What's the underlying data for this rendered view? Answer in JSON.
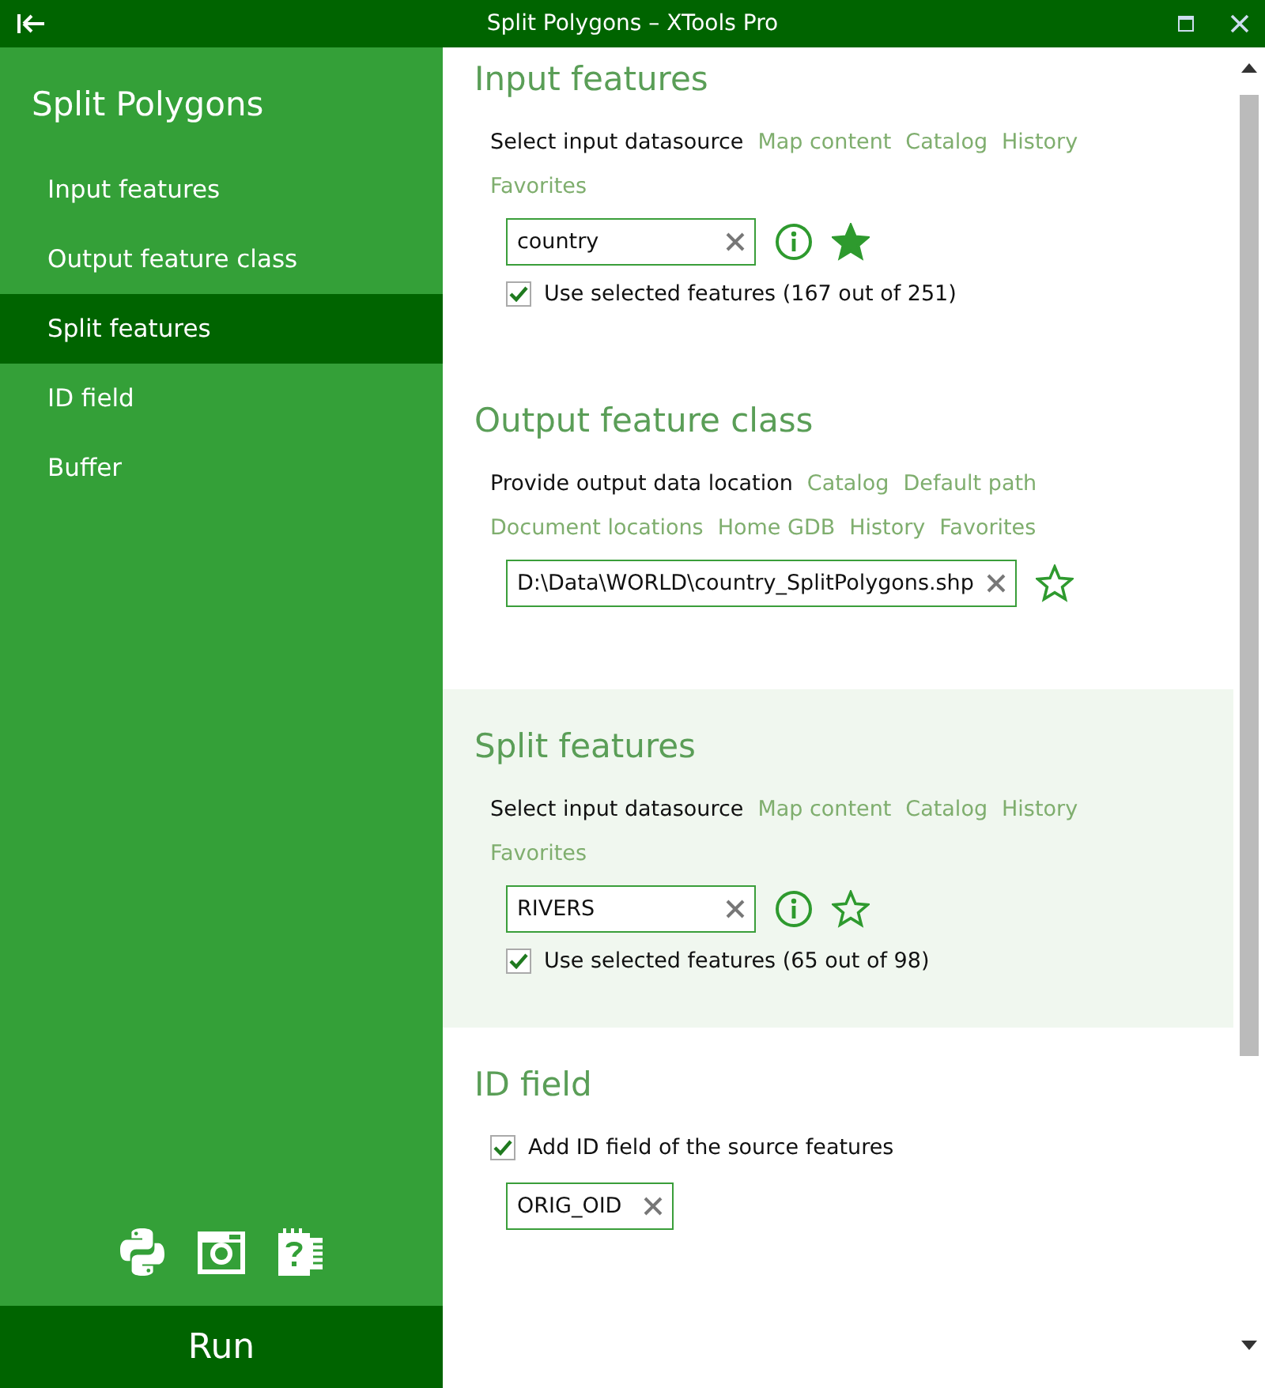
{
  "window": {
    "title": "Split Polygons – XTools Pro"
  },
  "sidebar": {
    "title": "Split Polygons",
    "items": [
      {
        "label": "Input features",
        "selected": false
      },
      {
        "label": "Output feature class",
        "selected": false
      },
      {
        "label": "Split features",
        "selected": true
      },
      {
        "label": "ID field",
        "selected": false
      },
      {
        "label": "Buffer",
        "selected": false
      }
    ],
    "run_button": "Run"
  },
  "sections": [
    {
      "kind": "datasource",
      "title": "Input features",
      "selected": false,
      "prompt": "Select input datasource",
      "links": [
        "Map content",
        "Catalog",
        "History",
        "Favorites"
      ],
      "field": "country",
      "favorite": true,
      "checkbox": {
        "label": "Use selected features (167 out of 251)",
        "checked": true
      }
    },
    {
      "kind": "output",
      "title": "Output feature class",
      "selected": false,
      "prompt": "Provide output data location",
      "links": [
        "Catalog",
        "Default path",
        "Document locations",
        "Home GDB",
        "History",
        "Favorites"
      ],
      "field": "D:\\Data\\WORLD\\country_SplitPolygons.shp",
      "favorite": false
    },
    {
      "kind": "datasource",
      "title": "Split features",
      "selected": true,
      "prompt": "Select input datasource",
      "links": [
        "Map content",
        "Catalog",
        "History",
        "Favorites"
      ],
      "field": "RIVERS",
      "favorite": false,
      "checkbox": {
        "label": "Use selected features (65 out of 98)",
        "checked": true
      }
    },
    {
      "kind": "idfield",
      "title": "ID field",
      "selected": false,
      "checkbox": {
        "label": "Add ID field of the source features",
        "checked": true
      },
      "field": "ORIG_OID"
    }
  ]
}
